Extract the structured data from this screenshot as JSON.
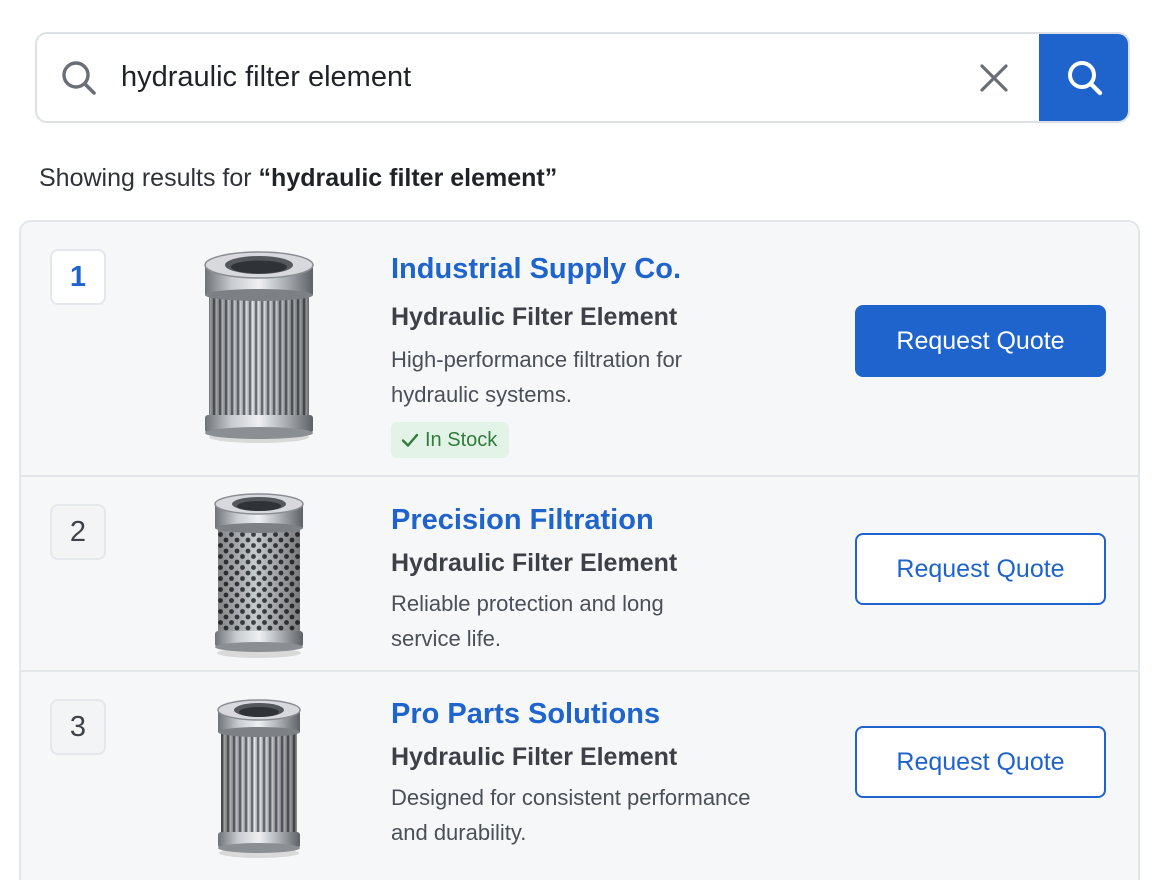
{
  "search": {
    "value": "hydraulic filter element",
    "placeholder": "Search products"
  },
  "results_header": {
    "prefix": "Showing results for ",
    "query": "“hydraulic filter element”"
  },
  "results": [
    {
      "rank": "1",
      "supplier": "Industrial Supply Co.",
      "product": "Hydraulic Filter Element",
      "desc_line1": "High-performance filtration for",
      "desc_line2": "hydraulic systems.",
      "stock": "In Stock",
      "button": "Request Quote",
      "image": "pleated-filter-element"
    },
    {
      "rank": "2",
      "supplier": "Precision Filtration",
      "product": "Hydraulic Filter Element",
      "desc_line1": "Reliable protection and long",
      "desc_line2": "service life.",
      "button": "Request Quote",
      "image": "perforated-filter-element"
    },
    {
      "rank": "3",
      "supplier": "Pro Parts Solutions",
      "product": "Hydraulic Filter Element",
      "desc_line1": "Designed for consistent performance",
      "desc_line2": "and durability.",
      "button": "Request Quote",
      "image": "pleated-filter-element"
    }
  ],
  "colors": {
    "accent": "#1f63cc",
    "stock_bg": "#e4f3e7",
    "stock_text": "#2e7d3a"
  }
}
